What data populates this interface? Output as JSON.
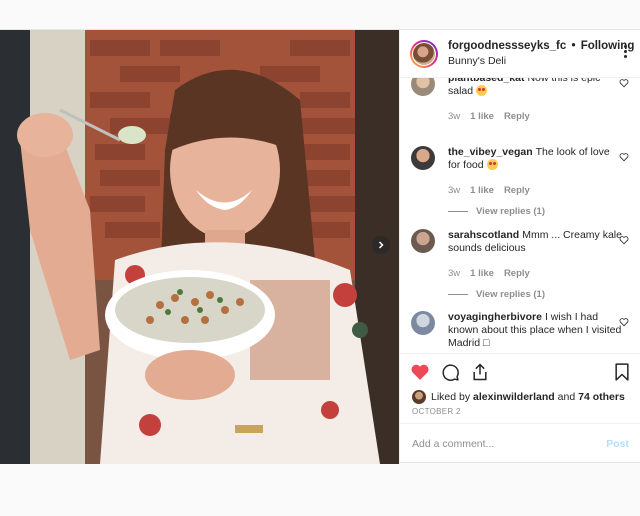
{
  "post": {
    "username": "forgoodnessseyks_fc",
    "separator": "•",
    "follow_label": "Following",
    "location": "Bunny's Deli"
  },
  "comments": [
    {
      "username": "plantbased_kat",
      "text": "Now this is epic salad",
      "emoji": "heart-eyes",
      "age": "3w",
      "likes": "1 like",
      "reply": "Reply",
      "replies": ""
    },
    {
      "username": "the_vibey_vegan",
      "text": "The look of love for food",
      "emoji": "heart-eyes",
      "age": "3w",
      "likes": "1 like",
      "reply": "Reply",
      "replies": "View replies (1)"
    },
    {
      "username": "sarahscotland",
      "text": "Mmm ... Creamy kale sounds delicious",
      "emoji": "",
      "age": "3w",
      "likes": "1 like",
      "reply": "Reply",
      "replies": "View replies (1)"
    },
    {
      "username": "voyagingherbivore",
      "text": "I wish I had known about this place when I visited Madrid □",
      "emoji": "",
      "age": "",
      "likes": "",
      "reply": "",
      "replies": ""
    }
  ],
  "likes": {
    "prefix": "Liked by",
    "user": "alexinwilderland",
    "joiner": "and",
    "others": "74 others"
  },
  "date": "OCTOBER 2",
  "add_comment": {
    "placeholder": "Add a comment...",
    "post_label": "Post"
  },
  "colors": {
    "like_red": "#ed4956",
    "post_disabled_blue": "#b2dffc",
    "meta_gray": "#8e8e8e"
  },
  "icons": [
    "heart-icon",
    "comment-icon",
    "share-icon",
    "bookmark-icon",
    "more-options-icon",
    "chevron-right-icon"
  ]
}
